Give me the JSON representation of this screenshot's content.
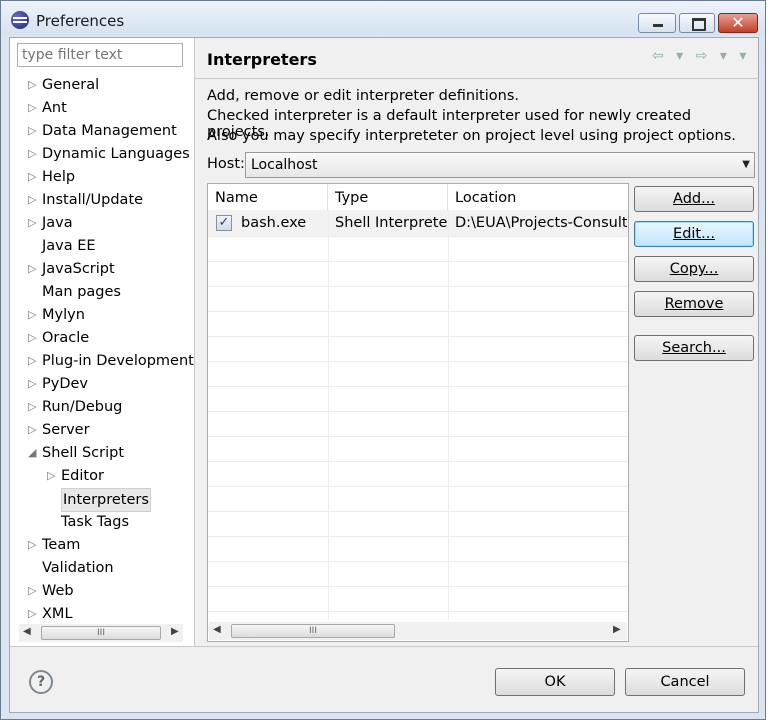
{
  "window": {
    "title": "Preferences",
    "minimize_icon": "minimize-icon",
    "maximize_icon": "maximize-icon",
    "close_icon": "close-icon",
    "close_glyph": "✕"
  },
  "filter": {
    "placeholder": "type filter text"
  },
  "tree": [
    {
      "label": "General",
      "expandable": true,
      "level": 0
    },
    {
      "label": "Ant",
      "expandable": true,
      "level": 0
    },
    {
      "label": "Data Management",
      "expandable": true,
      "level": 0
    },
    {
      "label": "Dynamic Languages",
      "expandable": true,
      "level": 0
    },
    {
      "label": "Help",
      "expandable": true,
      "level": 0
    },
    {
      "label": "Install/Update",
      "expandable": true,
      "level": 0
    },
    {
      "label": "Java",
      "expandable": true,
      "level": 0
    },
    {
      "label": "Java EE",
      "expandable": false,
      "level": 0
    },
    {
      "label": "JavaScript",
      "expandable": true,
      "level": 0
    },
    {
      "label": "Man pages",
      "expandable": false,
      "level": 0
    },
    {
      "label": "Mylyn",
      "expandable": true,
      "level": 0
    },
    {
      "label": "Oracle",
      "expandable": true,
      "level": 0
    },
    {
      "label": "Plug-in Development",
      "expandable": true,
      "level": 0
    },
    {
      "label": "PyDev",
      "expandable": true,
      "level": 0
    },
    {
      "label": "Run/Debug",
      "expandable": true,
      "level": 0
    },
    {
      "label": "Server",
      "expandable": true,
      "level": 0
    },
    {
      "label": "Shell Script",
      "expandable": true,
      "expanded": true,
      "level": 0
    },
    {
      "label": "Editor",
      "expandable": true,
      "level": 1
    },
    {
      "label": "Interpreters",
      "expandable": false,
      "level": 1,
      "selected": true
    },
    {
      "label": "Task Tags",
      "expandable": false,
      "level": 1
    },
    {
      "label": "Team",
      "expandable": true,
      "level": 0
    },
    {
      "label": "Validation",
      "expandable": false,
      "level": 0
    },
    {
      "label": "Web",
      "expandable": true,
      "level": 0
    },
    {
      "label": "XML",
      "expandable": true,
      "level": 0
    }
  ],
  "page": {
    "title": "Interpreters",
    "nav_icons": "⇦ ▾ ⇨ ▾ ▾",
    "description": [
      "Add, remove or edit interpreter definitions.",
      "Checked interpreter is a default interpreter used for newly created projects.",
      "Also you may specify interpreteter on project level using project options."
    ],
    "host_label": "Host:",
    "host_value": "Localhost"
  },
  "table": {
    "columns": [
      "Name",
      "Type",
      "Location"
    ],
    "rows": [
      {
        "checked": true,
        "name": "bash.exe",
        "type": "Shell Interpreter",
        "location": "D:\\EUA\\Projects-Consultin"
      }
    ]
  },
  "buttons": {
    "add": "Add...",
    "edit": "Edit...",
    "copy": "Copy...",
    "remove": "Remove",
    "search": "Search...",
    "ok": "OK",
    "cancel": "Cancel"
  },
  "glyphs": {
    "check": "✓",
    "help": "?",
    "left": "◀",
    "right": "▶",
    "grip": "III",
    "dropdown": "▼",
    "collapsed": "▷",
    "expanded": "◢"
  }
}
